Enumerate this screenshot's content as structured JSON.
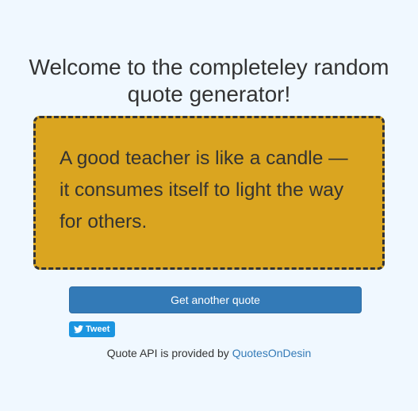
{
  "page": {
    "title": "Welcome to the completeley random quote generator!"
  },
  "quote": {
    "text": "A good teacher is like a candle — it consumes itself to light the way for others."
  },
  "actions": {
    "new_quote_label": "Get another quote",
    "tweet_label": "Tweet"
  },
  "footer": {
    "attribution_prefix": "Quote API is provided by",
    "attribution_link": "QuotesOnDesin"
  },
  "colors": {
    "background": "#f0f8ff",
    "quote_box": "#daa520",
    "primary_button": "#337ab7",
    "tweet_button": "#1b95e0",
    "text": "#333333"
  },
  "icons": {
    "tweet": "twitter-bird-icon"
  }
}
